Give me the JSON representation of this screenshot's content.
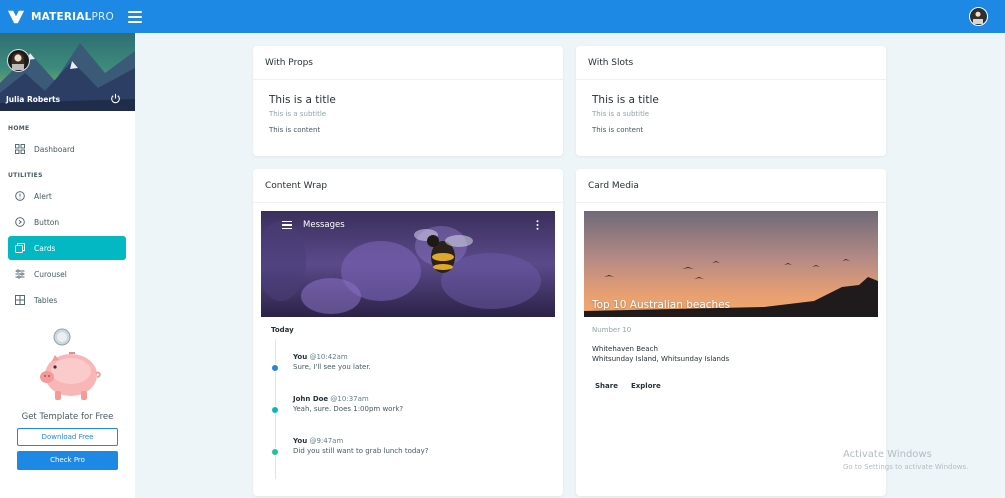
{
  "header": {
    "brand_bold": "MATERIAL",
    "brand_light": "PRO",
    "menu_icon": "hamburger-icon",
    "avatar_icon": "user-avatar"
  },
  "sidebar": {
    "profile_name": "Julia Roberts",
    "sections": {
      "home": "HOME",
      "utilities": "UTILITIES"
    },
    "items": [
      {
        "label": "Dashboard",
        "icon": "dashboard-icon",
        "active": false
      },
      {
        "label": "Alert",
        "icon": "alert-circle-icon",
        "active": false
      },
      {
        "label": "Button",
        "icon": "button-circle-icon",
        "active": false
      },
      {
        "label": "Cards",
        "icon": "cards-icon",
        "active": true
      },
      {
        "label": "Curousel",
        "icon": "sliders-icon",
        "active": false
      },
      {
        "label": "Tables",
        "icon": "table-icon",
        "active": false
      }
    ],
    "promo": {
      "text": "Get Template for Free",
      "download_label": "Download Free",
      "pro_label": "Check Pro"
    }
  },
  "cards": {
    "with_props": {
      "header": "With Props",
      "title": "This is a title",
      "subtitle": "This is a subtitle",
      "content": "This is content"
    },
    "with_slots": {
      "header": "With Slots",
      "title": "This is a title",
      "subtitle": "This is a subtitle",
      "content": "This is content"
    },
    "content_wrap": {
      "header": "Content Wrap",
      "toolbar_title": "Messages",
      "today_label": "Today",
      "messages": [
        {
          "who": "You",
          "time": "@10:42am",
          "text": "Sure, I'll see you later.",
          "color": "#1e88e5"
        },
        {
          "who": "John Doe",
          "time": "@10:37am",
          "text": "Yeah, sure. Does 1:00pm work?",
          "color": "#03b8c3"
        },
        {
          "who": "You",
          "time": "@9:47am",
          "text": "Did you still want to grab lunch today?",
          "color": "#21c1a0"
        }
      ]
    },
    "card_media": {
      "header": "Card Media",
      "image_title": "Top 10 Australian beaches",
      "number": "Number 10",
      "line1": "Whitehaven Beach",
      "line2": "Whitsunday Island, Whitsunday Islands",
      "share_label": "Share",
      "explore_label": "Explore"
    }
  },
  "watermark": {
    "line1": "Activate Windows",
    "line2": "Go to Settings to activate Windows."
  },
  "colors": {
    "primary": "#1e88e5",
    "active_nav": "#03b8c3",
    "background": "#eef5f9"
  }
}
